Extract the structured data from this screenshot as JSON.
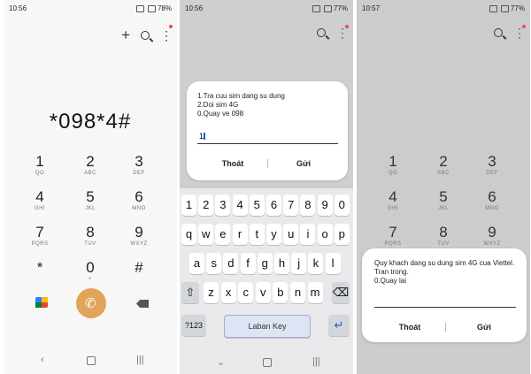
{
  "panel1": {
    "status": {
      "time": "10:56",
      "battery": "78%"
    },
    "dialed_number": "*098*4#",
    "keypad": [
      {
        "d": "1",
        "l": "QO"
      },
      {
        "d": "2",
        "l": "ABC"
      },
      {
        "d": "3",
        "l": "DEF"
      },
      {
        "d": "4",
        "l": "GHI"
      },
      {
        "d": "5",
        "l": "JKL"
      },
      {
        "d": "6",
        "l": "MNO"
      },
      {
        "d": "7",
        "l": "PQRS"
      },
      {
        "d": "8",
        "l": "TUV"
      },
      {
        "d": "9",
        "l": "WXYZ"
      },
      {
        "d": "*",
        "l": ""
      },
      {
        "d": "0",
        "l": "+"
      },
      {
        "d": "#",
        "l": ""
      }
    ],
    "toolbar": {
      "add": "+",
      "menu": "⋮"
    }
  },
  "panel2": {
    "status": {
      "time": "10:56",
      "battery": "77%"
    },
    "menu_lines": [
      "1.Tra cuu sim dang su dung",
      "2.Doi sim 4G",
      "0.Quay ve 098"
    ],
    "input_value": "1",
    "cancel_label": "Thoát",
    "send_label": "Gửi",
    "keyboard": {
      "row1": [
        "1",
        "2",
        "3",
        "4",
        "5",
        "6",
        "7",
        "8",
        "9",
        "0"
      ],
      "row2": [
        "q",
        "w",
        "e",
        "r",
        "t",
        "y",
        "u",
        "i",
        "o",
        "p"
      ],
      "row3": [
        "a",
        "s",
        "d",
        "f",
        "g",
        "h",
        "j",
        "k",
        "l"
      ],
      "row4": [
        "z",
        "x",
        "c",
        "v",
        "b",
        "n",
        "m"
      ],
      "symbols_label": "?123",
      "space_label": "Laban Key",
      "enter_label": "↵",
      "shift_label": "⇧",
      "backspace_label": "⌫"
    }
  },
  "panel3": {
    "status": {
      "time": "10:57",
      "battery": "77%"
    },
    "message_lines": [
      "Quy khach dang su dung sim 4G cua Viettel.",
      "Tran trong.",
      "0.Quay lai"
    ],
    "cancel_label": "Thoát",
    "send_label": "Gửi",
    "keypad": [
      {
        "d": "1",
        "l": "QO"
      },
      {
        "d": "2",
        "l": "ABC"
      },
      {
        "d": "3",
        "l": "DEF"
      },
      {
        "d": "4",
        "l": "GHI"
      },
      {
        "d": "5",
        "l": "JKL"
      },
      {
        "d": "6",
        "l": "MNO"
      },
      {
        "d": "7",
        "l": "PQRS"
      },
      {
        "d": "8",
        "l": "TUV"
      },
      {
        "d": "9",
        "l": "WXYZ"
      }
    ]
  },
  "colors": {
    "call_button": "#e2a45b",
    "notification_dot": "#e5524f",
    "cursor": "#1e5bd7"
  },
  "icons": [
    "add-icon",
    "search-icon",
    "more-options-icon",
    "phone-icon",
    "google-meet-icon",
    "backspace-icon",
    "back-nav-icon",
    "home-nav-icon",
    "recents-nav-icon"
  ]
}
